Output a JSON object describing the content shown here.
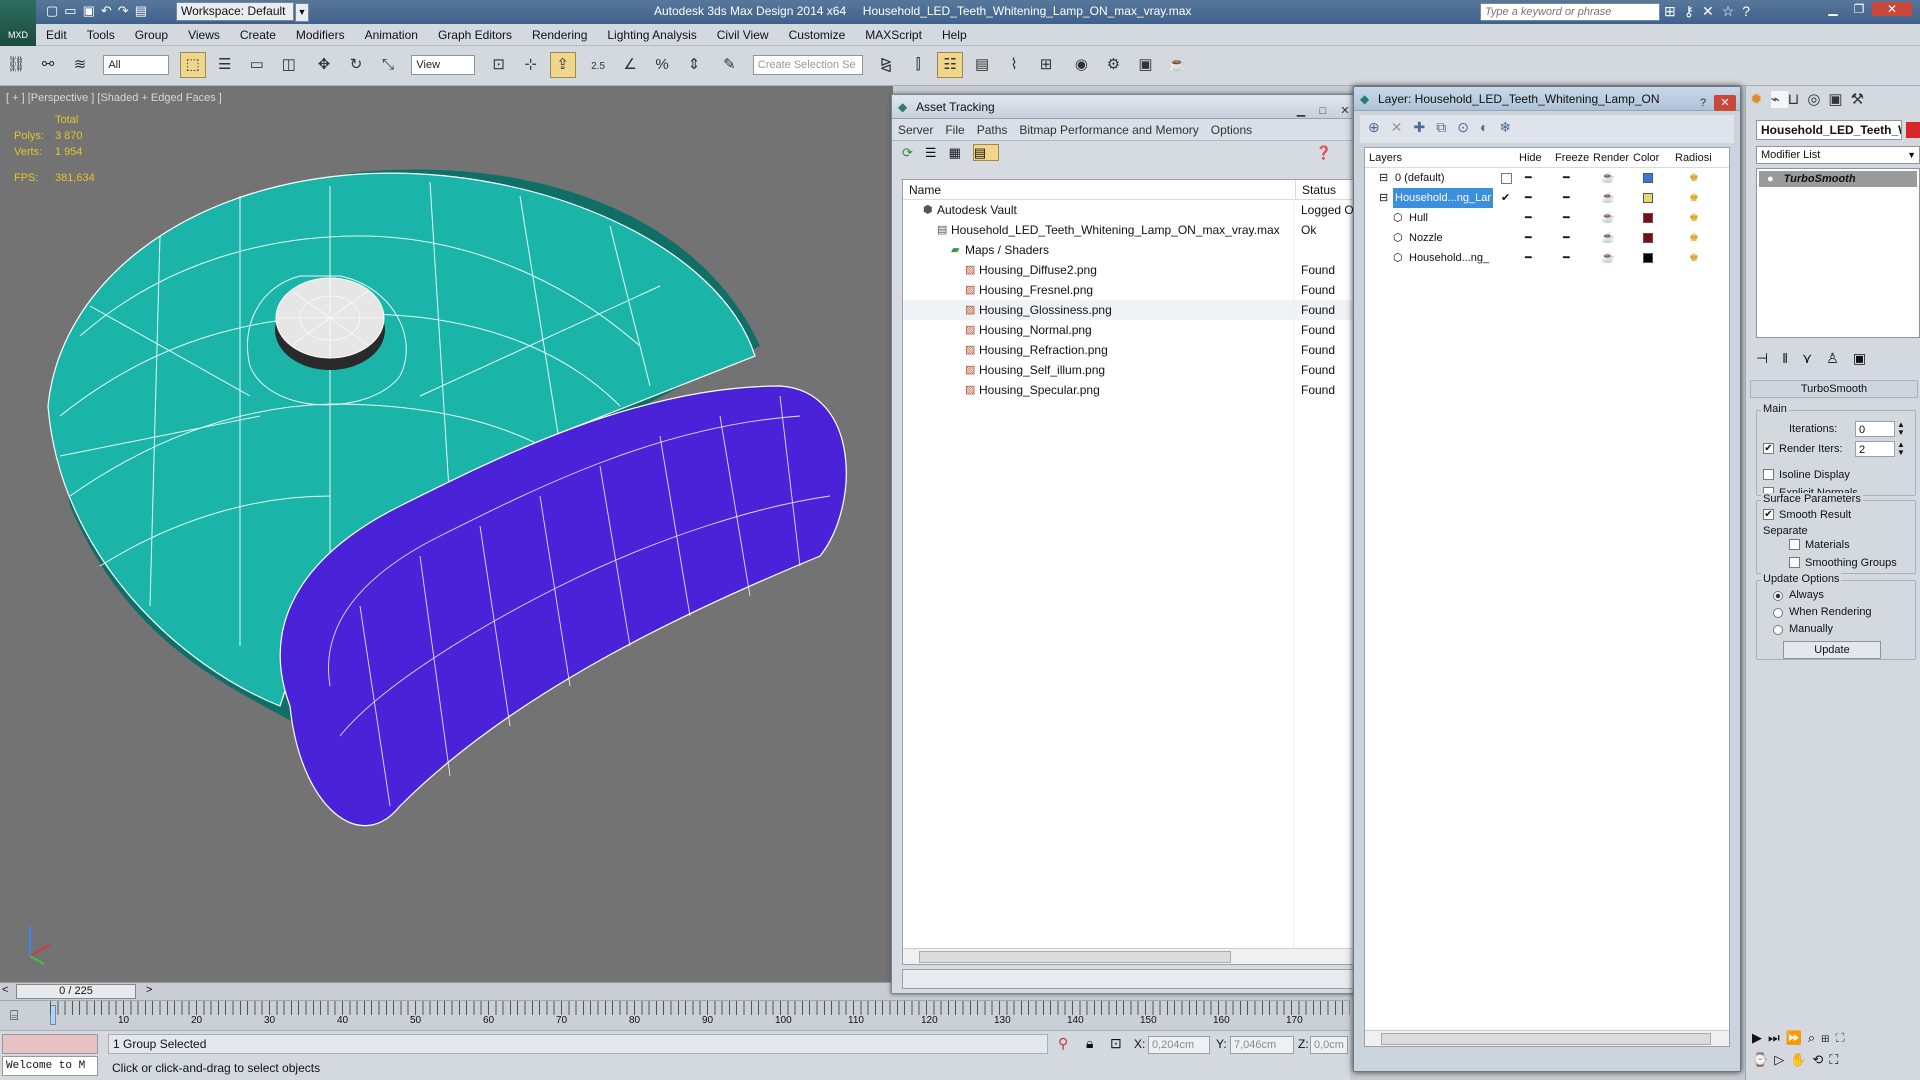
{
  "titlebar": {
    "logo": "MXD",
    "workspace": "Workspace: Default",
    "title": "Autodesk 3ds Max Design 2014 x64     Household_LED_Teeth_Whitening_Lamp_ON_max_vray.max",
    "search_placeholder": "Type a keyword or phrase"
  },
  "menu": [
    "Edit",
    "Tools",
    "Group",
    "Views",
    "Create",
    "Modifiers",
    "Animation",
    "Graph Editors",
    "Rendering",
    "Lighting Analysis",
    "Civil View",
    "Customize",
    "MAXScript",
    "Help"
  ],
  "toolbar": {
    "filter": "All",
    "refcoord": "View",
    "snap_angle": "2.5",
    "selection_set_placeholder": "Create Selection Se"
  },
  "viewport": {
    "label": "[ + ] [Perspective ] [Shaded + Edged Faces ]",
    "stats": {
      "total_label": "Total",
      "polys_label": "Polys:",
      "polys": "3 870",
      "verts_label": "Verts:",
      "verts": "1 954",
      "fps_label": "FPS:",
      "fps": "381,634"
    },
    "colors": {
      "body": "#1ab5a8",
      "band": "#4a22d8",
      "knob": "#e6e6e6",
      "bg": "#737373"
    }
  },
  "timeline": {
    "frame": "0 / 225",
    "ticks": [
      "10",
      "20",
      "30",
      "40",
      "50",
      "60",
      "70",
      "80",
      "90",
      "100",
      "110",
      "120",
      "130",
      "140",
      "150",
      "160",
      "170"
    ]
  },
  "statusbar": {
    "welcome": "Welcome to M",
    "selection": "1 Group Selected",
    "prompt": "Click or click-and-drag to select objects",
    "x_label": "X:",
    "x": "0,204cm",
    "y_label": "Y:",
    "y": "7,046cm",
    "z_label": "Z:",
    "z": "0,0cm"
  },
  "asset_tracking": {
    "title": "Asset Tracking",
    "menu": [
      "Server",
      "File",
      "Paths",
      "Bitmap Performance and Memory",
      "Options"
    ],
    "col_name": "Name",
    "col_status": "Status",
    "rows": [
      {
        "name": "Autodesk Vault",
        "status": "Logged Out",
        "indent": 0,
        "icon": "vault-icon"
      },
      {
        "name": "Household_LED_Teeth_Whitening_Lamp_ON_max_vray.max",
        "status": "Ok",
        "indent": 1,
        "icon": "max-file-icon"
      },
      {
        "name": "Maps / Shaders",
        "status": "",
        "indent": 2,
        "icon": "folder-icon"
      },
      {
        "name": "Housing_Diffuse2.png",
        "status": "Found",
        "indent": 3,
        "icon": "image-file-icon"
      },
      {
        "name": "Housing_Fresnel.png",
        "status": "Found",
        "indent": 3,
        "icon": "image-file-icon"
      },
      {
        "name": "Housing_Glossiness.png",
        "status": "Found",
        "indent": 3,
        "icon": "image-file-icon"
      },
      {
        "name": "Housing_Normal.png",
        "status": "Found",
        "indent": 3,
        "icon": "image-file-icon"
      },
      {
        "name": "Housing_Refraction.png",
        "status": "Found",
        "indent": 3,
        "icon": "image-file-icon"
      },
      {
        "name": "Housing_Self_illum.png",
        "status": "Found",
        "indent": 3,
        "icon": "image-file-icon"
      },
      {
        "name": "Housing_Specular.png",
        "status": "Found",
        "indent": 3,
        "icon": "image-file-icon"
      }
    ]
  },
  "layer_window": {
    "title": "Layer: Household_LED_Teeth_Whitening_Lamp_ON",
    "cols": [
      "Layers",
      "Hide",
      "Freeze",
      "Render",
      "Color",
      "Radiosi"
    ],
    "rows": [
      {
        "name": "0 (default)",
        "color": "#3a78d8",
        "selected": false,
        "active": false,
        "indent": 0
      },
      {
        "name": "Household...ng_Lar",
        "color": "#e8d870",
        "selected": true,
        "active": true,
        "indent": 0
      },
      {
        "name": "Hull",
        "color": "#7a0c12",
        "selected": false,
        "active": false,
        "indent": 1
      },
      {
        "name": "Nozzle",
        "color": "#7a0c12",
        "selected": false,
        "active": false,
        "indent": 1
      },
      {
        "name": "Household...ng_",
        "color": "#000000",
        "selected": false,
        "active": false,
        "indent": 1
      }
    ]
  },
  "command_panel": {
    "object_name": "Household_LED_Teeth_W",
    "modifier_list": "Modifier List",
    "stack_item": "TurboSmooth",
    "rollout_title": "TurboSmooth",
    "main_label": "Main",
    "iterations_label": "Iterations:",
    "iterations": "0",
    "render_iters_label": "Render Iters:",
    "render_iters": "2",
    "render_iters_checked": true,
    "isoline_label": "Isoline Display",
    "isoline_checked": false,
    "explicit_normals_label": "Explicit Normals",
    "explicit_normals_checked": false,
    "surface_params_label": "Surface Parameters",
    "smooth_result_label": "Smooth Result",
    "smooth_result_checked": true,
    "separate_label": "Separate",
    "materials_label": "Materials",
    "smoothing_groups_label": "Smoothing Groups",
    "update_options_label": "Update Options",
    "always_label": "Always",
    "when_rendering_label": "When Rendering",
    "manually_label": "Manually",
    "update_button": "Update"
  }
}
